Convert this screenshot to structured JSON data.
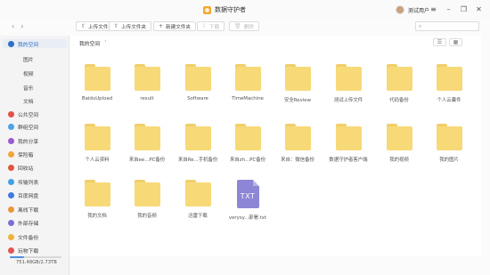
{
  "window": {
    "title": "数据守护者",
    "user_name": "测试用户",
    "controls": [
      "≡",
      "–",
      "❐",
      "✕"
    ]
  },
  "toolbar": {
    "nav": {
      "back": "‹",
      "forward": "›"
    },
    "buttons": [
      {
        "label": "上传文件",
        "icon": "upload-icon",
        "glyph": "⇧",
        "enabled": true
      },
      {
        "label": "上传文件夹",
        "icon": "upload-folder-icon",
        "glyph": "⇧",
        "enabled": true
      },
      {
        "label": "新建文件夹",
        "icon": "new-folder-icon",
        "glyph": "+",
        "enabled": true
      },
      {
        "label": "下载",
        "icon": "download-icon",
        "glyph": "⇩",
        "enabled": false
      },
      {
        "label": "删除",
        "icon": "delete-icon",
        "glyph": "🗑",
        "enabled": false
      }
    ],
    "search": {
      "placeholder": "",
      "icon": "search-icon",
      "glyph": "⌕"
    }
  },
  "sidebar": {
    "items": [
      {
        "label": "我的空间",
        "icon": "cloud-icon",
        "color": "#2f6fc6",
        "active": true
      },
      {
        "label": "图片",
        "indent": true
      },
      {
        "label": "视频",
        "indent": true
      },
      {
        "label": "音乐",
        "indent": true
      },
      {
        "label": "文档",
        "indent": true
      },
      {
        "label": "公共空间",
        "icon": "public-space-icon",
        "color": "#e2514a"
      },
      {
        "label": "群组空间",
        "icon": "group-space-icon",
        "color": "#4aa3e8"
      },
      {
        "label": "我的分享",
        "icon": "share-icon",
        "color": "#9b59d0"
      },
      {
        "label": "保险箱",
        "icon": "safe-icon",
        "color": "#f0a63a"
      },
      {
        "label": "回收站",
        "icon": "trash-icon",
        "color": "#e0563d"
      },
      {
        "label": "传输列表",
        "icon": "transfer-icon",
        "color": "#3fa1e6"
      },
      {
        "label": "百度网盘",
        "icon": "baidu-icon",
        "color": "#3d7be0"
      },
      {
        "label": "离线下载",
        "icon": "offline-download-icon",
        "color": "#e9963a"
      },
      {
        "label": "外部存储",
        "icon": "external-storage-icon",
        "color": "#7a6fd8"
      },
      {
        "label": "文件备份",
        "icon": "backup-icon",
        "color": "#f2b13a"
      },
      {
        "label": "玩物下载",
        "icon": "wanwu-download-icon",
        "color": "#e45454"
      }
    ],
    "storage": {
      "text": "751.48GB/2.73TB",
      "used_fraction": 0.27
    }
  },
  "main": {
    "breadcrumb": [
      "我的空间"
    ],
    "breadcrumb_chevron": "›",
    "view_buttons": [
      {
        "glyph": "☰",
        "icon": "list-view-icon"
      },
      {
        "glyph": "▦",
        "icon": "grid-view-icon"
      }
    ],
    "items": [
      {
        "name": "BaiduUpload",
        "type": "folder"
      },
      {
        "name": "result",
        "type": "folder"
      },
      {
        "name": "Software",
        "type": "folder"
      },
      {
        "name": "TimeMachine",
        "type": "folder"
      },
      {
        "name": "安全Review",
        "type": "folder"
      },
      {
        "name": "测试上传文件",
        "type": "folder"
      },
      {
        "name": "代码备份",
        "type": "folder"
      },
      {
        "name": "个人云囊件",
        "type": "folder"
      },
      {
        "name": "个人云资料",
        "type": "folder"
      },
      {
        "name": "来自ee...PC备份",
        "type": "folder"
      },
      {
        "name": "来自Re...手机备份",
        "type": "folder"
      },
      {
        "name": "来自zh...PC备份",
        "type": "folder"
      },
      {
        "name": "来自：微信备份",
        "type": "folder"
      },
      {
        "name": "数据守护者客户端",
        "type": "folder"
      },
      {
        "name": "我的视频",
        "type": "folder"
      },
      {
        "name": "我的图片",
        "type": "folder"
      },
      {
        "name": "我的文档",
        "type": "folder"
      },
      {
        "name": "我的音频",
        "type": "folder"
      },
      {
        "name": "迅雷下载",
        "type": "folder"
      },
      {
        "name": "verysy...部署.txt",
        "type": "txt",
        "ext": "TXT"
      }
    ]
  }
}
